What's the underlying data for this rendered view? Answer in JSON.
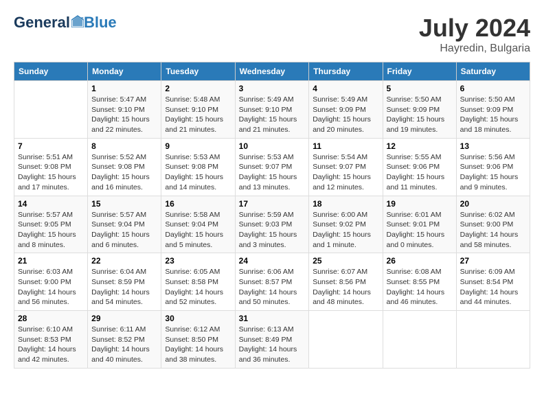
{
  "header": {
    "logo_general": "General",
    "logo_blue": "Blue",
    "month": "July 2024",
    "location": "Hayredin, Bulgaria"
  },
  "days_of_week": [
    "Sunday",
    "Monday",
    "Tuesday",
    "Wednesday",
    "Thursday",
    "Friday",
    "Saturday"
  ],
  "weeks": [
    [
      {
        "day": "",
        "info": ""
      },
      {
        "day": "1",
        "info": "Sunrise: 5:47 AM\nSunset: 9:10 PM\nDaylight: 15 hours\nand 22 minutes."
      },
      {
        "day": "2",
        "info": "Sunrise: 5:48 AM\nSunset: 9:10 PM\nDaylight: 15 hours\nand 21 minutes."
      },
      {
        "day": "3",
        "info": "Sunrise: 5:49 AM\nSunset: 9:10 PM\nDaylight: 15 hours\nand 21 minutes."
      },
      {
        "day": "4",
        "info": "Sunrise: 5:49 AM\nSunset: 9:09 PM\nDaylight: 15 hours\nand 20 minutes."
      },
      {
        "day": "5",
        "info": "Sunrise: 5:50 AM\nSunset: 9:09 PM\nDaylight: 15 hours\nand 19 minutes."
      },
      {
        "day": "6",
        "info": "Sunrise: 5:50 AM\nSunset: 9:09 PM\nDaylight: 15 hours\nand 18 minutes."
      }
    ],
    [
      {
        "day": "7",
        "info": "Sunrise: 5:51 AM\nSunset: 9:08 PM\nDaylight: 15 hours\nand 17 minutes."
      },
      {
        "day": "8",
        "info": "Sunrise: 5:52 AM\nSunset: 9:08 PM\nDaylight: 15 hours\nand 16 minutes."
      },
      {
        "day": "9",
        "info": "Sunrise: 5:53 AM\nSunset: 9:08 PM\nDaylight: 15 hours\nand 14 minutes."
      },
      {
        "day": "10",
        "info": "Sunrise: 5:53 AM\nSunset: 9:07 PM\nDaylight: 15 hours\nand 13 minutes."
      },
      {
        "day": "11",
        "info": "Sunrise: 5:54 AM\nSunset: 9:07 PM\nDaylight: 15 hours\nand 12 minutes."
      },
      {
        "day": "12",
        "info": "Sunrise: 5:55 AM\nSunset: 9:06 PM\nDaylight: 15 hours\nand 11 minutes."
      },
      {
        "day": "13",
        "info": "Sunrise: 5:56 AM\nSunset: 9:06 PM\nDaylight: 15 hours\nand 9 minutes."
      }
    ],
    [
      {
        "day": "14",
        "info": "Sunrise: 5:57 AM\nSunset: 9:05 PM\nDaylight: 15 hours\nand 8 minutes."
      },
      {
        "day": "15",
        "info": "Sunrise: 5:57 AM\nSunset: 9:04 PM\nDaylight: 15 hours\nand 6 minutes."
      },
      {
        "day": "16",
        "info": "Sunrise: 5:58 AM\nSunset: 9:04 PM\nDaylight: 15 hours\nand 5 minutes."
      },
      {
        "day": "17",
        "info": "Sunrise: 5:59 AM\nSunset: 9:03 PM\nDaylight: 15 hours\nand 3 minutes."
      },
      {
        "day": "18",
        "info": "Sunrise: 6:00 AM\nSunset: 9:02 PM\nDaylight: 15 hours\nand 1 minute."
      },
      {
        "day": "19",
        "info": "Sunrise: 6:01 AM\nSunset: 9:01 PM\nDaylight: 15 hours\nand 0 minutes."
      },
      {
        "day": "20",
        "info": "Sunrise: 6:02 AM\nSunset: 9:00 PM\nDaylight: 14 hours\nand 58 minutes."
      }
    ],
    [
      {
        "day": "21",
        "info": "Sunrise: 6:03 AM\nSunset: 9:00 PM\nDaylight: 14 hours\nand 56 minutes."
      },
      {
        "day": "22",
        "info": "Sunrise: 6:04 AM\nSunset: 8:59 PM\nDaylight: 14 hours\nand 54 minutes."
      },
      {
        "day": "23",
        "info": "Sunrise: 6:05 AM\nSunset: 8:58 PM\nDaylight: 14 hours\nand 52 minutes."
      },
      {
        "day": "24",
        "info": "Sunrise: 6:06 AM\nSunset: 8:57 PM\nDaylight: 14 hours\nand 50 minutes."
      },
      {
        "day": "25",
        "info": "Sunrise: 6:07 AM\nSunset: 8:56 PM\nDaylight: 14 hours\nand 48 minutes."
      },
      {
        "day": "26",
        "info": "Sunrise: 6:08 AM\nSunset: 8:55 PM\nDaylight: 14 hours\nand 46 minutes."
      },
      {
        "day": "27",
        "info": "Sunrise: 6:09 AM\nSunset: 8:54 PM\nDaylight: 14 hours\nand 44 minutes."
      }
    ],
    [
      {
        "day": "28",
        "info": "Sunrise: 6:10 AM\nSunset: 8:53 PM\nDaylight: 14 hours\nand 42 minutes."
      },
      {
        "day": "29",
        "info": "Sunrise: 6:11 AM\nSunset: 8:52 PM\nDaylight: 14 hours\nand 40 minutes."
      },
      {
        "day": "30",
        "info": "Sunrise: 6:12 AM\nSunset: 8:50 PM\nDaylight: 14 hours\nand 38 minutes."
      },
      {
        "day": "31",
        "info": "Sunrise: 6:13 AM\nSunset: 8:49 PM\nDaylight: 14 hours\nand 36 minutes."
      },
      {
        "day": "",
        "info": ""
      },
      {
        "day": "",
        "info": ""
      },
      {
        "day": "",
        "info": ""
      }
    ]
  ]
}
